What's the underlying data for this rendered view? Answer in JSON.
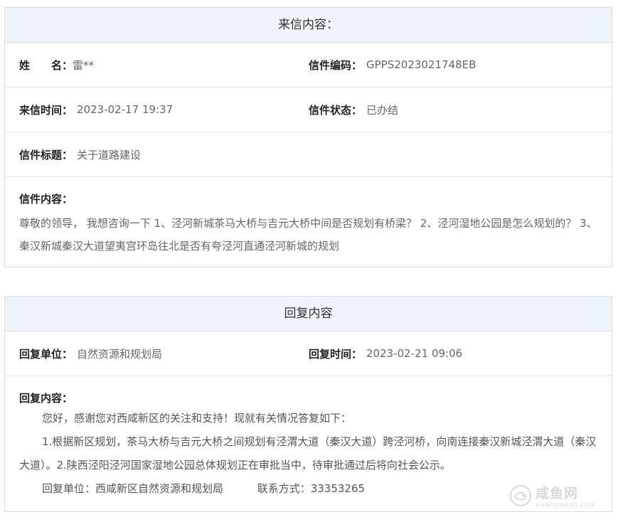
{
  "letter": {
    "header": "来信内容：",
    "name_label": "姓　　名：",
    "name_value": "雷**",
    "code_label": "信件编码：",
    "code_value": "GPPS2023021748EB",
    "time_label": "来信时间：",
    "time_value": "2023-02-17 19:37",
    "status_label": "信件状态：",
    "status_value": "已办结",
    "subject_label": "信件标题：",
    "subject_value": "关于道路建设",
    "content_label": "信件内容：",
    "content_value": "尊敬的领导， 我想咨询一下 1、泾河新城茶马大桥与吉元大桥中间是否规划有桥梁？ 2、泾河湿地公园是怎么规划的？ 3、秦汉新城秦汉大道望夷宫环岛往北是否有夸泾河直通泾河新城的规划"
  },
  "reply": {
    "header": "回复内容",
    "unit_label": "回复单位：",
    "unit_value": "自然资源和规划局",
    "time_label": "回复时间：",
    "time_value": "2023-02-21 09:06",
    "content_label": "回复内容：",
    "para1": "您好，感谢您对西咸新区的关注和支持！现就有关情况答复如下：",
    "para2": "1.根据新区规划，茶马大桥与吉元大桥之间规划有泾渭大道（秦汉大道）跨泾河桥，向南连接秦汉新城泾渭大道（秦汉大道）。2.陕西泾阳泾河国家湿地公园总体规划正在审批当中，待审批通过后将向社会公示。",
    "sig_unit": "回复单位：西咸新区自然资源和规划局",
    "sig_contact": "联系方式：33353265"
  },
  "watermark": {
    "icon": "fish-logo-icon",
    "main": "咸鱼网",
    "sub": "XIANYUWANG.COM"
  }
}
